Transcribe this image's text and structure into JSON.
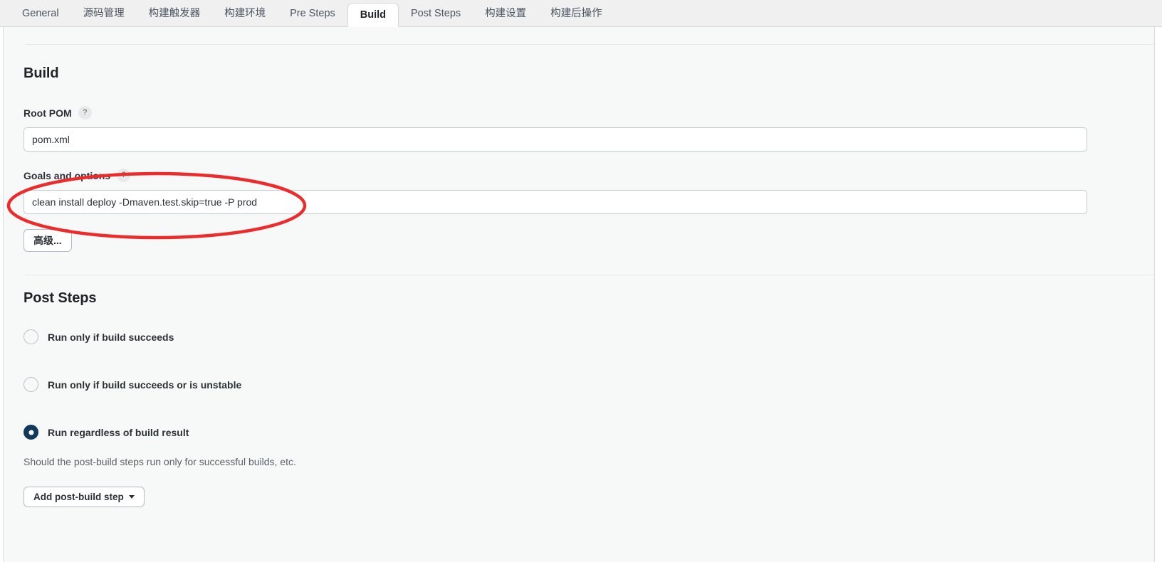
{
  "tabs": [
    {
      "label": "General",
      "active": false
    },
    {
      "label": "源码管理",
      "active": false
    },
    {
      "label": "构建触发器",
      "active": false
    },
    {
      "label": "构建环境",
      "active": false
    },
    {
      "label": "Pre Steps",
      "active": false
    },
    {
      "label": "Build",
      "active": true
    },
    {
      "label": "Post Steps",
      "active": false
    },
    {
      "label": "构建设置",
      "active": false
    },
    {
      "label": "构建后操作",
      "active": false
    }
  ],
  "build_section": {
    "title": "Build",
    "root_pom": {
      "label": "Root POM",
      "help": "?",
      "value": "pom.xml",
      "placeholder": "pom.xml"
    },
    "goals": {
      "label": "Goals and options",
      "help": "?",
      "value": "clean install deploy -Dmaven.test.skip=true -P prod",
      "placeholder": ""
    },
    "advanced_button": "高级..."
  },
  "post_steps_section": {
    "title": "Post Steps",
    "options": [
      {
        "label": "Run only if build succeeds",
        "checked": false
      },
      {
        "label": "Run only if build succeeds or is unstable",
        "checked": false
      },
      {
        "label": "Run regardless of build result",
        "checked": true
      }
    ],
    "help_text": "Should the post-build steps run only for successful builds, etc.",
    "add_step_button": "Add post-build step",
    "add_step_caret": "▾"
  },
  "annotation": {
    "shape": "ellipse",
    "color": "#ee2b2b",
    "stroke_width": 4,
    "target": "Goals and options"
  },
  "colors": {
    "tabbar_background": "#f0f0f0",
    "panel_background": "#f7f8f8",
    "active_tab_background": "#ffffff",
    "radio_selected": "#12395c",
    "annotation_red": "#ee2b2b",
    "border": "#d7dade"
  }
}
